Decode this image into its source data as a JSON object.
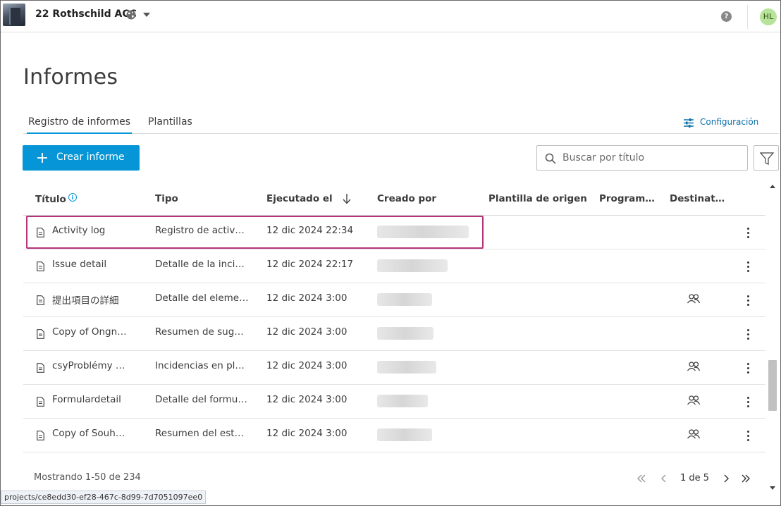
{
  "header": {
    "project_name": "22 Rothschild ACC",
    "help_label": "?",
    "avatar_initials": "HL"
  },
  "page": {
    "title": "Informes"
  },
  "tabs": [
    {
      "label": "Registro de informes",
      "active": true
    },
    {
      "label": "Plantillas",
      "active": false
    }
  ],
  "settings": {
    "label": "Configuración"
  },
  "toolbar": {
    "create_label": "Crear informe",
    "search_placeholder": "Buscar por título"
  },
  "table": {
    "columns": {
      "title": "Título",
      "type": "Tipo",
      "executed": "Ejecutado el",
      "created_by": "Creado por",
      "template": "Plantilla de origen",
      "schedule": "Program…",
      "recipients": "Destinat…"
    },
    "rows": [
      {
        "title": "Activity log",
        "type": "Registro de activ…",
        "executed": "12 dic 2024 22:34",
        "has_recipients": false
      },
      {
        "title": "Issue detail",
        "type": "Detalle de la inci…",
        "executed": "12 dic 2024 22:17",
        "has_recipients": false
      },
      {
        "title": "提出項目の詳細",
        "type": "Detalle del eleme…",
        "executed": "12 dic 2024 3:00",
        "has_recipients": true
      },
      {
        "title": "Copy of Ongn…",
        "type": "Resumen de sug…",
        "executed": "12 dic 2024 3:00",
        "has_recipients": false
      },
      {
        "title": "csyProblémy …",
        "type": "Incidencias en pl…",
        "executed": "12 dic 2024 3:00",
        "has_recipients": true
      },
      {
        "title": "Formulardetail",
        "type": "Detalle del formu…",
        "executed": "12 dic 2024 3:00",
        "has_recipients": true
      },
      {
        "title": "Copy of Souh…",
        "type": "Resumen del est…",
        "executed": "12 dic 2024 3:00",
        "has_recipients": true
      }
    ]
  },
  "footer": {
    "showing": "Mostrando 1-50 de 234",
    "page": "1 de 5"
  },
  "status_bar": {
    "url": "projects/ce8edd30-ef28-467c-8d99-7d7051097ee0"
  },
  "colors": {
    "accent": "#0696d7",
    "highlight": "#b5337a",
    "link": "#0b6ea8"
  }
}
